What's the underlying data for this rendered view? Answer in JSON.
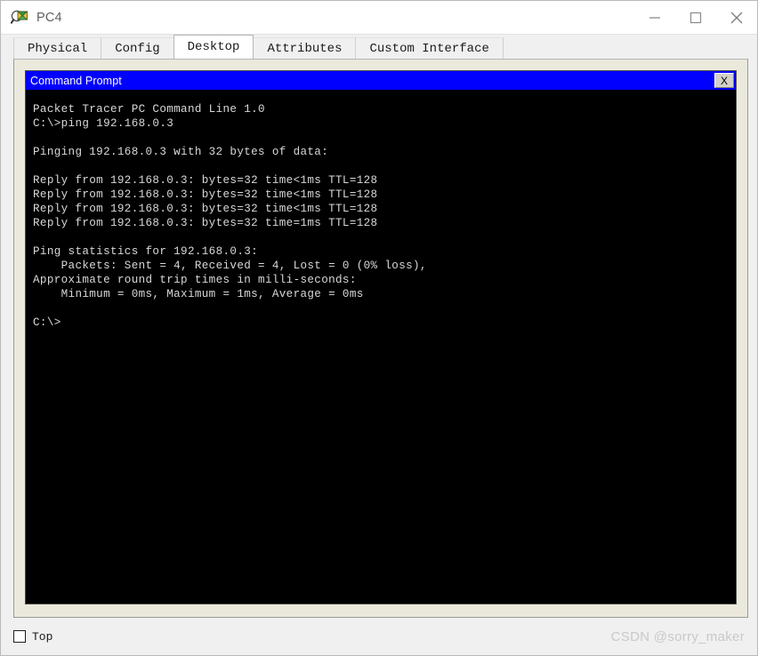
{
  "window": {
    "title": "PC4",
    "icon": "packet-tracer-pc-icon",
    "controls": {
      "minimize": "minimize-icon",
      "maximize": "maximize-icon",
      "close": "close-icon"
    }
  },
  "tabs": [
    {
      "label": "Physical",
      "active": false
    },
    {
      "label": "Config",
      "active": false
    },
    {
      "label": "Desktop",
      "active": true
    },
    {
      "label": "Attributes",
      "active": false
    },
    {
      "label": "Custom Interface",
      "active": false
    }
  ],
  "command_prompt": {
    "title": "Command Prompt",
    "close_label": "X",
    "terminal_text": "Packet Tracer PC Command Line 1.0\nC:\\>ping 192.168.0.3\n\nPinging 192.168.0.3 with 32 bytes of data:\n\nReply from 192.168.0.3: bytes=32 time<1ms TTL=128\nReply from 192.168.0.3: bytes=32 time<1ms TTL=128\nReply from 192.168.0.3: bytes=32 time<1ms TTL=128\nReply from 192.168.0.3: bytes=32 time=1ms TTL=128\n\nPing statistics for 192.168.0.3:\n    Packets: Sent = 4, Received = 4, Lost = 0 (0% loss),\nApproximate round trip times in milli-seconds:\n    Minimum = 0ms, Maximum = 1ms, Average = 0ms\n\nC:\\>",
    "lines": [
      "Packet Tracer PC Command Line 1.0",
      "C:\\>ping 192.168.0.3",
      "",
      "Pinging 192.168.0.3 with 32 bytes of data:",
      "",
      "Reply from 192.168.0.3: bytes=32 time<1ms TTL=128",
      "Reply from 192.168.0.3: bytes=32 time<1ms TTL=128",
      "Reply from 192.168.0.3: bytes=32 time<1ms TTL=128",
      "Reply from 192.168.0.3: bytes=32 time=1ms TTL=128",
      "",
      "Ping statistics for 192.168.0.3:",
      "    Packets: Sent = 4, Received = 4, Lost = 0 (0% loss),",
      "Approximate round trip times in milli-seconds:",
      "    Minimum = 0ms, Maximum = 1ms, Average = 0ms",
      "",
      "C:\\>"
    ],
    "ping_target": "192.168.0.3",
    "packets_sent": "4",
    "packets_received": "4",
    "packets_lost": "0",
    "loss_percent": "0%",
    "minimum_time": "0ms",
    "maximum_time": "1ms",
    "average_time": "0ms",
    "bytes": "32",
    "ttl": "128"
  },
  "footer": {
    "top_checkbox_label": "Top",
    "top_checkbox_checked": false,
    "watermark": "CSDN @sorry_maker"
  },
  "colors": {
    "cmd_titlebar": "#0000ff",
    "terminal_bg": "#000000",
    "terminal_fg": "#d8d8d8",
    "panel_bg": "#ebe9dc"
  }
}
